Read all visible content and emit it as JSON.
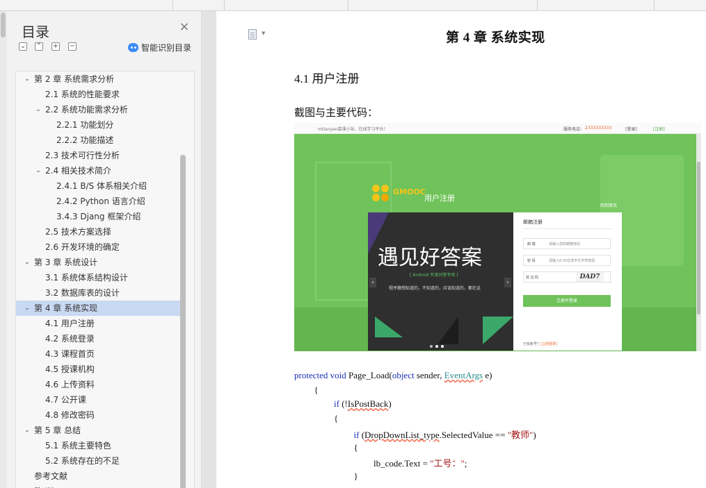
{
  "navigation": {
    "title": "目录",
    "close_glyph": "×",
    "ai_toc_label": "智能识别目录",
    "toolbar_glyphs": [
      "⌄",
      "⌃",
      "+",
      "−"
    ]
  },
  "toc": [
    {
      "text": "第 2 章  系统需求分析",
      "level": 0,
      "caret": "⌄"
    },
    {
      "text": "2.1 系统的性能要求",
      "level": 1,
      "caret": ""
    },
    {
      "text": "2.2 系统功能需求分析",
      "level": 1,
      "caret": "⌄"
    },
    {
      "text": "2.2.1 功能划分",
      "level": 2,
      "caret": ""
    },
    {
      "text": "2.2.2 功能描述",
      "level": 2,
      "caret": ""
    },
    {
      "text": "2.3 技术可行性分析",
      "level": 1,
      "caret": ""
    },
    {
      "text": "2.4 相关技术简介",
      "level": 1,
      "caret": "⌄"
    },
    {
      "text": "2.4.1 B/S 体系相关介绍",
      "level": 2,
      "caret": ""
    },
    {
      "text": "2.4.2 Python 语言介绍",
      "level": 2,
      "caret": ""
    },
    {
      "text": "3.4.3 Djang 框架介绍",
      "level": 2,
      "caret": ""
    },
    {
      "text": "2.5 技术方案选择",
      "level": 1,
      "caret": ""
    },
    {
      "text": "2.6 开发环境的确定",
      "level": 1,
      "caret": ""
    },
    {
      "text": "第 3 章  系统设计",
      "level": 0,
      "caret": "⌄"
    },
    {
      "text": "3.1 系统体系结构设计",
      "level": 1,
      "caret": ""
    },
    {
      "text": "3.2 数据库表的设计",
      "level": 1,
      "caret": ""
    },
    {
      "text": "第 4 章  系统实现",
      "level": 0,
      "caret": "⌄",
      "active": true
    },
    {
      "text": "4.1 用户注册",
      "level": 1,
      "caret": ""
    },
    {
      "text": "4.2 系统登录",
      "level": 1,
      "caret": ""
    },
    {
      "text": "4.3 课程首页",
      "level": 1,
      "caret": ""
    },
    {
      "text": "4.5 授课机构",
      "level": 1,
      "caret": ""
    },
    {
      "text": "4.6 上传资料",
      "level": 1,
      "caret": ""
    },
    {
      "text": "4.7 公开课",
      "level": 1,
      "caret": ""
    },
    {
      "text": "4.8 修改密码",
      "level": 1,
      "caret": ""
    },
    {
      "text": "第 5 章  总结",
      "level": 0,
      "caret": "⌄"
    },
    {
      "text": "5.1 系统主要特色",
      "level": 1,
      "caret": ""
    },
    {
      "text": "5.2 系统存在的不足",
      "level": 1,
      "caret": ""
    },
    {
      "text": "参考文献",
      "level": 0,
      "caret": ""
    },
    {
      "text": "致    谢",
      "level": 0,
      "caret": ""
    }
  ],
  "document": {
    "chapter_title": "第 4 章  系统实现",
    "section_title": "4.1 用户注册",
    "caption": "截图与主要代码：",
    "page_icon": "document-icon",
    "page_icon_caret": "▼"
  },
  "screenshot": {
    "welcome": "mtianyan慕课小站，在线学习平台！",
    "phone_label": "服务电话：",
    "phone": "2333333333",
    "login": "[登录]",
    "register": "[注册]",
    "logo": "GMOOC",
    "page_title": "用户注册",
    "back_home": "回到首页",
    "promo_big": "遇见好答案",
    "promo_sub": "[ Android 开发问答专场 ]",
    "promo_slogan": "程序猿想知道的，不知道的，应该知道的，都在这",
    "form_title": "邮箱注册",
    "email_label": "邮    箱",
    "email_placeholder": "请输入您的邮箱地址",
    "password_label": "密    码",
    "password_placeholder": "请输入6-20位非中文字符密码",
    "captcha_label": "验 证 码",
    "captcha_text": "DAD7",
    "submit": "注册并登录",
    "has_account": "已有账号？",
    "login_now": "[立即登录]"
  },
  "code_lines": [
    {
      "indent": 0,
      "parts": [
        [
          "kw",
          "protected"
        ],
        [
          "",
          " "
        ],
        [
          "kw",
          "void"
        ],
        [
          "",
          " Page_Load("
        ],
        [
          "kw",
          "object"
        ],
        [
          "",
          " sender, "
        ],
        [
          "ty",
          "EventArgs"
        ],
        [
          "",
          " e)"
        ]
      ]
    },
    {
      "indent": 1,
      "parts": [
        [
          "",
          "{"
        ]
      ]
    },
    {
      "indent": 2,
      "parts": [
        [
          "kw",
          "if"
        ],
        [
          "",
          " (!"
        ],
        [
          "sq",
          "IsPostBack"
        ],
        [
          "",
          ")"
        ]
      ]
    },
    {
      "indent": 2,
      "parts": [
        [
          "",
          "{"
        ]
      ]
    },
    {
      "indent": 3,
      "parts": [
        [
          "kw",
          "if"
        ],
        [
          "",
          " ("
        ],
        [
          "sq",
          "DropDownList_type"
        ],
        [
          "",
          ".SelectedValue == "
        ],
        [
          "st",
          "\"教师\""
        ],
        [
          "",
          ")"
        ]
      ]
    },
    {
      "indent": 3,
      "parts": [
        [
          "",
          "{"
        ]
      ]
    },
    {
      "indent": 4,
      "parts": [
        [
          "",
          "lb_code.Text = "
        ],
        [
          "st",
          "\"工号：\""
        ],
        [
          "",
          ";"
        ]
      ]
    },
    {
      "indent": 3,
      "parts": [
        [
          "",
          "}"
        ]
      ]
    }
  ]
}
